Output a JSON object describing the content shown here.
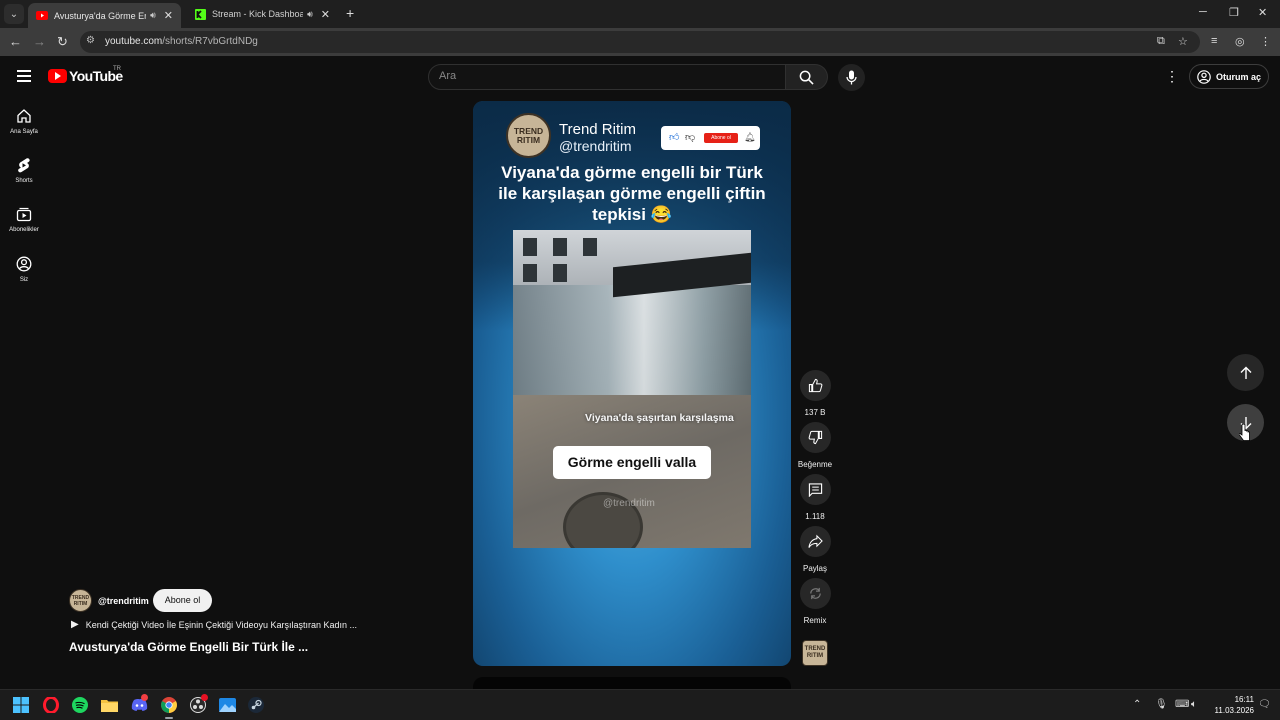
{
  "browser": {
    "tabs": [
      {
        "title": "Avusturya'da Görme Engelli Bi",
        "active": true,
        "favicon": "youtube-favicon"
      },
      {
        "title": "Stream - Kick Dashboard",
        "active": false,
        "favicon": "kick-favicon"
      }
    ],
    "url_host": "youtube.com",
    "url_path": "/shorts/R7vbGrtdNDg"
  },
  "youtube": {
    "logo_text": "YouTube",
    "country_code": "TR",
    "search_placeholder": "Ara",
    "signin_label": "Oturum aç",
    "sidebar": [
      {
        "label": "Ana Sayfa",
        "icon": "home-icon"
      },
      {
        "label": "Shorts",
        "icon": "shorts-icon"
      },
      {
        "label": "Abonelikler",
        "icon": "subscriptions-icon"
      },
      {
        "label": "Siz",
        "icon": "you-icon"
      }
    ]
  },
  "video": {
    "channel_name": "Trend Ritim",
    "channel_handle": "@trendritim",
    "logo_line1": "TREND",
    "logo_line2": "RITIM",
    "subscribe_card_label": "Abone ol",
    "headline": "Viyana'da görme engelli bir Türk ile karşılaşan görme engelli çiftin tepkisi 😂",
    "subtitle_small": "Viyana'da şaşırtan karşılaşma",
    "subtitle_big": "Görme engelli valla",
    "watermark": "@trendritim"
  },
  "actions": {
    "like_count": "137 B",
    "dislike_label": "Beğenme",
    "comment_count": "1.118",
    "share_label": "Paylaş",
    "remix_label": "Remix"
  },
  "meta": {
    "handle": "@trendritim",
    "subscribe_label": "Abone ol",
    "linked_video": "Kendi Çektiği Video İle Eşinin Çektiği Videoyu Karşılaştıran Kadın ...",
    "title": "Avusturya'da Görme Engelli Bir Türk İle ..."
  },
  "taskbar": {
    "time": "16:11",
    "date": "11.03.2026"
  }
}
